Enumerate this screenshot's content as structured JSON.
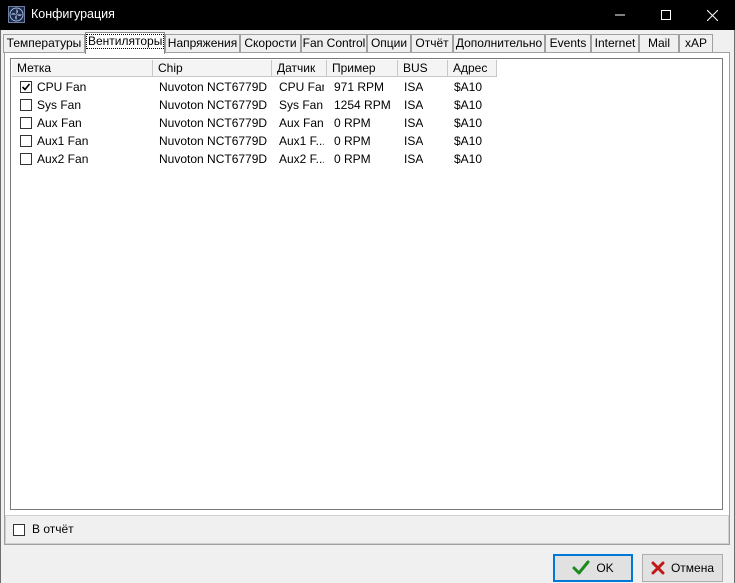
{
  "window": {
    "title": "Конфигурация",
    "minimize_glyph": "—",
    "maximize_glyph": "☐",
    "close_glyph": "✕"
  },
  "tabs": [
    {
      "label": "Температуры",
      "active": false
    },
    {
      "label": "Вентиляторы",
      "active": true
    },
    {
      "label": "Напряжения",
      "active": false
    },
    {
      "label": "Скорости",
      "active": false
    },
    {
      "label": "Fan Control",
      "active": false
    },
    {
      "label": "Опции",
      "active": false
    },
    {
      "label": "Отчёт",
      "active": false
    },
    {
      "label": "Дополнительно",
      "active": false
    },
    {
      "label": "Events",
      "active": false
    },
    {
      "label": "Internet",
      "active": false
    },
    {
      "label": "Mail",
      "active": false
    },
    {
      "label": "xAP",
      "active": false
    }
  ],
  "fans_table": {
    "columns": [
      "Метка",
      "Chip",
      "Датчик",
      "Пример",
      "BUS",
      "Адрес"
    ],
    "rows": [
      {
        "checked": true,
        "label": "CPU Fan",
        "chip": "Nuvoton NCT6779D",
        "sensor": "CPU Fan",
        "sample": "971 RPM",
        "bus": "ISA",
        "address": "$A10"
      },
      {
        "checked": false,
        "label": "Sys Fan",
        "chip": "Nuvoton NCT6779D",
        "sensor": "Sys Fan",
        "sample": "1254 RPM",
        "bus": "ISA",
        "address": "$A10"
      },
      {
        "checked": false,
        "label": "Aux Fan",
        "chip": "Nuvoton NCT6779D",
        "sensor": "Aux Fan",
        "sample": "0 RPM",
        "bus": "ISA",
        "address": "$A10"
      },
      {
        "checked": false,
        "label": "Aux1 Fan",
        "chip": "Nuvoton NCT6779D",
        "sensor": "Aux1 F...",
        "sample": "0 RPM",
        "bus": "ISA",
        "address": "$A10"
      },
      {
        "checked": false,
        "label": "Aux2 Fan",
        "chip": "Nuvoton NCT6779D",
        "sensor": "Aux2 F...",
        "sample": "0 RPM",
        "bus": "ISA",
        "address": "$A10"
      }
    ]
  },
  "report_checkbox": {
    "label": "В отчёт",
    "checked": false
  },
  "buttons": {
    "ok": "OK",
    "cancel": "Отмена"
  },
  "colors": {
    "ok_check": "#1e8a1e",
    "cancel_x": "#c01818",
    "focus_border": "#0078d7"
  }
}
